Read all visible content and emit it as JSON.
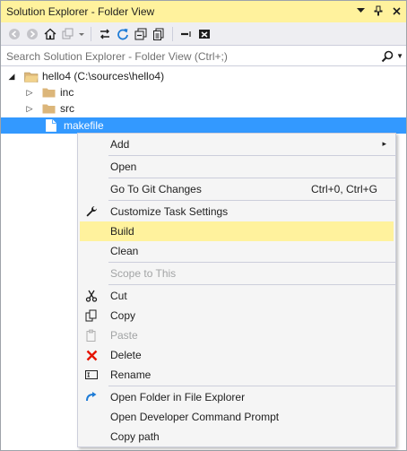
{
  "window": {
    "title": "Solution Explorer - Folder View",
    "title_icons": [
      "chevron-down-icon",
      "pin-icon",
      "close-icon"
    ]
  },
  "toolbar": {
    "icons": [
      "back-arrow-icon",
      "forward-arrow-icon",
      "home-icon",
      "switch-views-icon",
      "dropdown-icon",
      "sync-icon",
      "refresh-icon",
      "collapse-all-icon",
      "show-all-files-icon",
      "preview-icon",
      "properties-icon"
    ]
  },
  "search": {
    "placeholder": "Search Solution Explorer - Folder View (Ctrl+;)"
  },
  "tree": {
    "root": "hello4 (C:\\sources\\hello4)",
    "folders": [
      "inc",
      "src"
    ],
    "selected_file": "makefile"
  },
  "context_menu": {
    "items": [
      {
        "label": "Add",
        "has_submenu": true,
        "submenu_glyph": "▸"
      },
      {
        "label": "Open"
      },
      {
        "label": "Go To Git Changes",
        "shortcut": "Ctrl+0, Ctrl+G"
      },
      {
        "label": "Customize Task Settings",
        "icon": "wrench-icon"
      },
      {
        "label": "Build",
        "highlighted": true
      },
      {
        "label": "Clean"
      },
      {
        "label": "Scope to This",
        "disabled": true
      },
      {
        "label": "Cut",
        "icon": "scissors-icon"
      },
      {
        "label": "Copy",
        "icon": "copy-icon"
      },
      {
        "label": "Paste",
        "icon": "paste-icon",
        "disabled": true
      },
      {
        "label": "Delete",
        "icon": "delete-x-icon"
      },
      {
        "label": "Rename",
        "icon": "rename-icon"
      },
      {
        "label": "Open Folder in File Explorer",
        "icon": "open-folder-arrow-icon"
      },
      {
        "label": "Open Developer Command Prompt"
      },
      {
        "label": "Copy path"
      }
    ]
  },
  "colors": {
    "title_bar": "#fff29d",
    "highlight": "#fff29d",
    "selection": "#3399ff",
    "menu_bg": "#f5f5f5",
    "folder": "#dcb67a",
    "delete_red": "#e51400",
    "accent_blue": "#1e7bd6"
  }
}
